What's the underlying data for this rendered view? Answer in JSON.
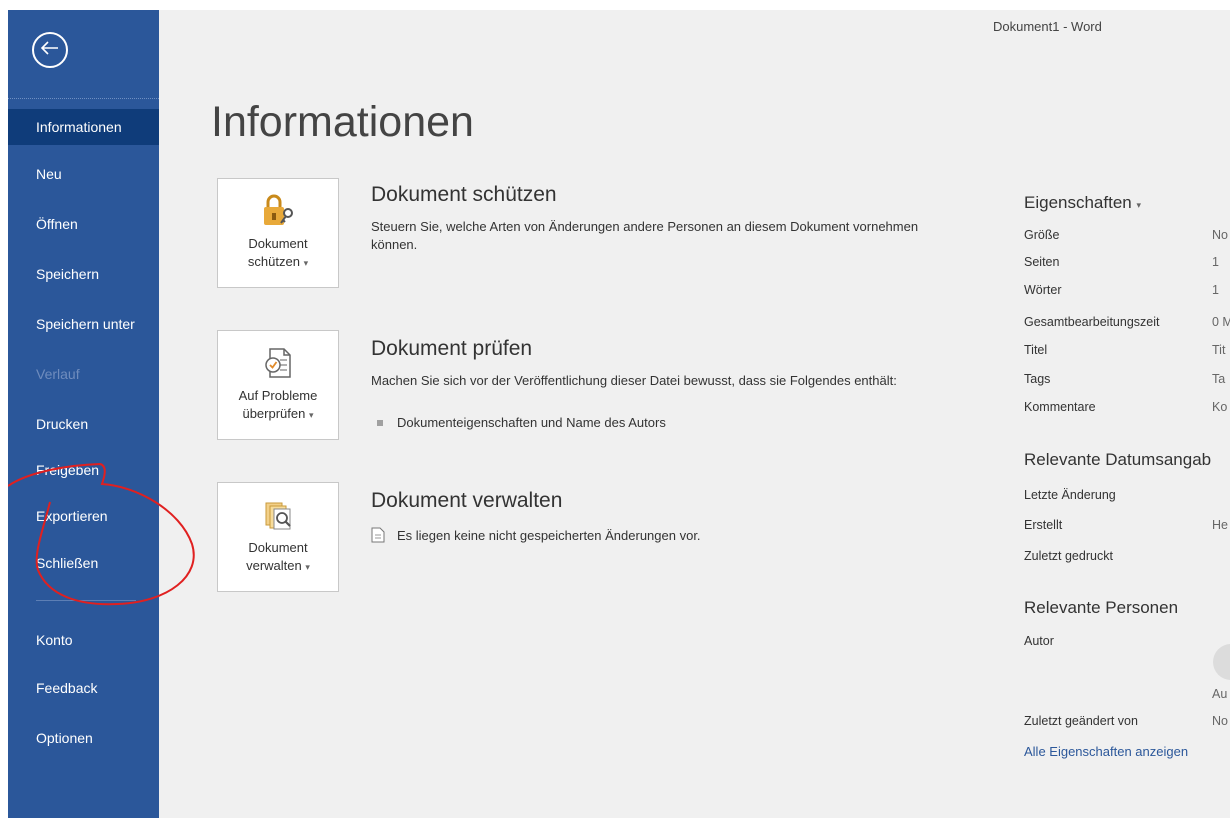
{
  "window": {
    "title": "Dokument1 - Word"
  },
  "sidebar": {
    "items": [
      {
        "label": "Informationen",
        "active": true
      },
      {
        "label": "Neu"
      },
      {
        "label": "Öffnen"
      },
      {
        "label": "Speichern"
      },
      {
        "label": "Speichern unter"
      },
      {
        "label": "Verlauf",
        "disabled": true
      },
      {
        "label": "Drucken"
      },
      {
        "label": "Freigeben"
      },
      {
        "label": "Exportieren"
      },
      {
        "label": "Schließen"
      },
      {
        "label": "Konto"
      },
      {
        "label": "Feedback"
      },
      {
        "label": "Optionen"
      }
    ]
  },
  "page": {
    "title": "Informationen"
  },
  "sections": {
    "protect": {
      "button_line1": "Dokument",
      "button_line2": "schützen",
      "heading": "Dokument schützen",
      "description": "Steuern Sie, welche Arten von Änderungen andere Personen an diesem Dokument vornehmen können."
    },
    "inspect": {
      "button_line1": "Auf Probleme",
      "button_line2": "überprüfen",
      "heading": "Dokument prüfen",
      "description": "Machen Sie sich vor der Veröffentlichung dieser Datei bewusst, dass sie Folgendes enthält:",
      "bullet": "Dokumenteigenschaften und Name des Autors"
    },
    "manage": {
      "button_line1": "Dokument",
      "button_line2": "verwalten",
      "heading": "Dokument verwalten",
      "info": "Es liegen keine nicht gespeicherten Änderungen vor."
    }
  },
  "properties": {
    "heading": "Eigenschaften",
    "rows": [
      {
        "label": "Größe",
        "value": "No"
      },
      {
        "label": "Seiten",
        "value": "1"
      },
      {
        "label": "Wörter",
        "value": "1"
      },
      {
        "label": "Gesamtbearbeitungszeit",
        "value": "0 M"
      },
      {
        "label": "Titel",
        "value": "Tit"
      },
      {
        "label": "Tags",
        "value": "Ta"
      },
      {
        "label": "Kommentare",
        "value": "Ko"
      }
    ],
    "dates_heading": "Relevante Datumsangab",
    "dates": [
      {
        "label": "Letzte Änderung",
        "value": ""
      },
      {
        "label": "Erstellt",
        "value": "He"
      },
      {
        "label": "Zuletzt gedruckt",
        "value": ""
      }
    ],
    "people_heading": "Relevante Personen",
    "author_label": "Autor",
    "author_name": "Au",
    "last_modified_by_label": "Zuletzt geändert von",
    "last_modified_by_value": "No",
    "all_properties_link": "Alle Eigenschaften anzeigen"
  },
  "colors": {
    "sidebar": "#2b579a",
    "sidebar_active": "#0f3c7a",
    "annotation": "#e02020"
  }
}
